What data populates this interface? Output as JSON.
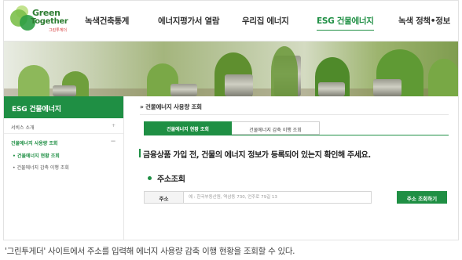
{
  "logo": {
    "line1": "Green",
    "line2": "Together",
    "sub": "그린투게더"
  },
  "nav": {
    "items": [
      {
        "label": "녹색건축통계"
      },
      {
        "label": "에너지평가서 열람"
      },
      {
        "label": "우리집 에너지"
      },
      {
        "label": "ESG 건물에너지"
      },
      {
        "label": "녹색 정책•정보"
      }
    ],
    "active_index": 3
  },
  "sidebar": {
    "title": "ESG 건물에너지",
    "items": [
      {
        "label": "서비스 소개",
        "mark": "+"
      },
      {
        "label": "건물에너지 사용량 조회",
        "mark": "—"
      }
    ],
    "subitems": [
      {
        "label": "• 건물에너지 현황 조회"
      },
      {
        "label": "• 건물에너지 감축 이행 조회"
      }
    ]
  },
  "content": {
    "breadcrumb": "» 건물에너지 사용량 조회",
    "tabs": [
      {
        "label": "건물에너지 현황 조회"
      },
      {
        "label": "건물에너지 감축 이행 조회"
      }
    ],
    "notice": "금융상품 가입 전, 건물의 에너지 정보가 등록되어 있는지 확인해 주세요.",
    "section_title": "주소조회",
    "address": {
      "label": "주소",
      "placeholder": "예 : 한국부동산원, 역삼동 730, 언주로 79길 13",
      "button": "주소 조회하기"
    }
  },
  "caption": "'그린투게더' 사이트에서 주소를 입력해 에너지 사용량 감축 이행 현황을 조회할 수 있다.",
  "colors": {
    "brand_green": "#1f8f44",
    "logo_green": "#2e7d32",
    "logo_accent": "#d32f2f"
  },
  "icons": {
    "section_bullet": "dot-icon"
  }
}
